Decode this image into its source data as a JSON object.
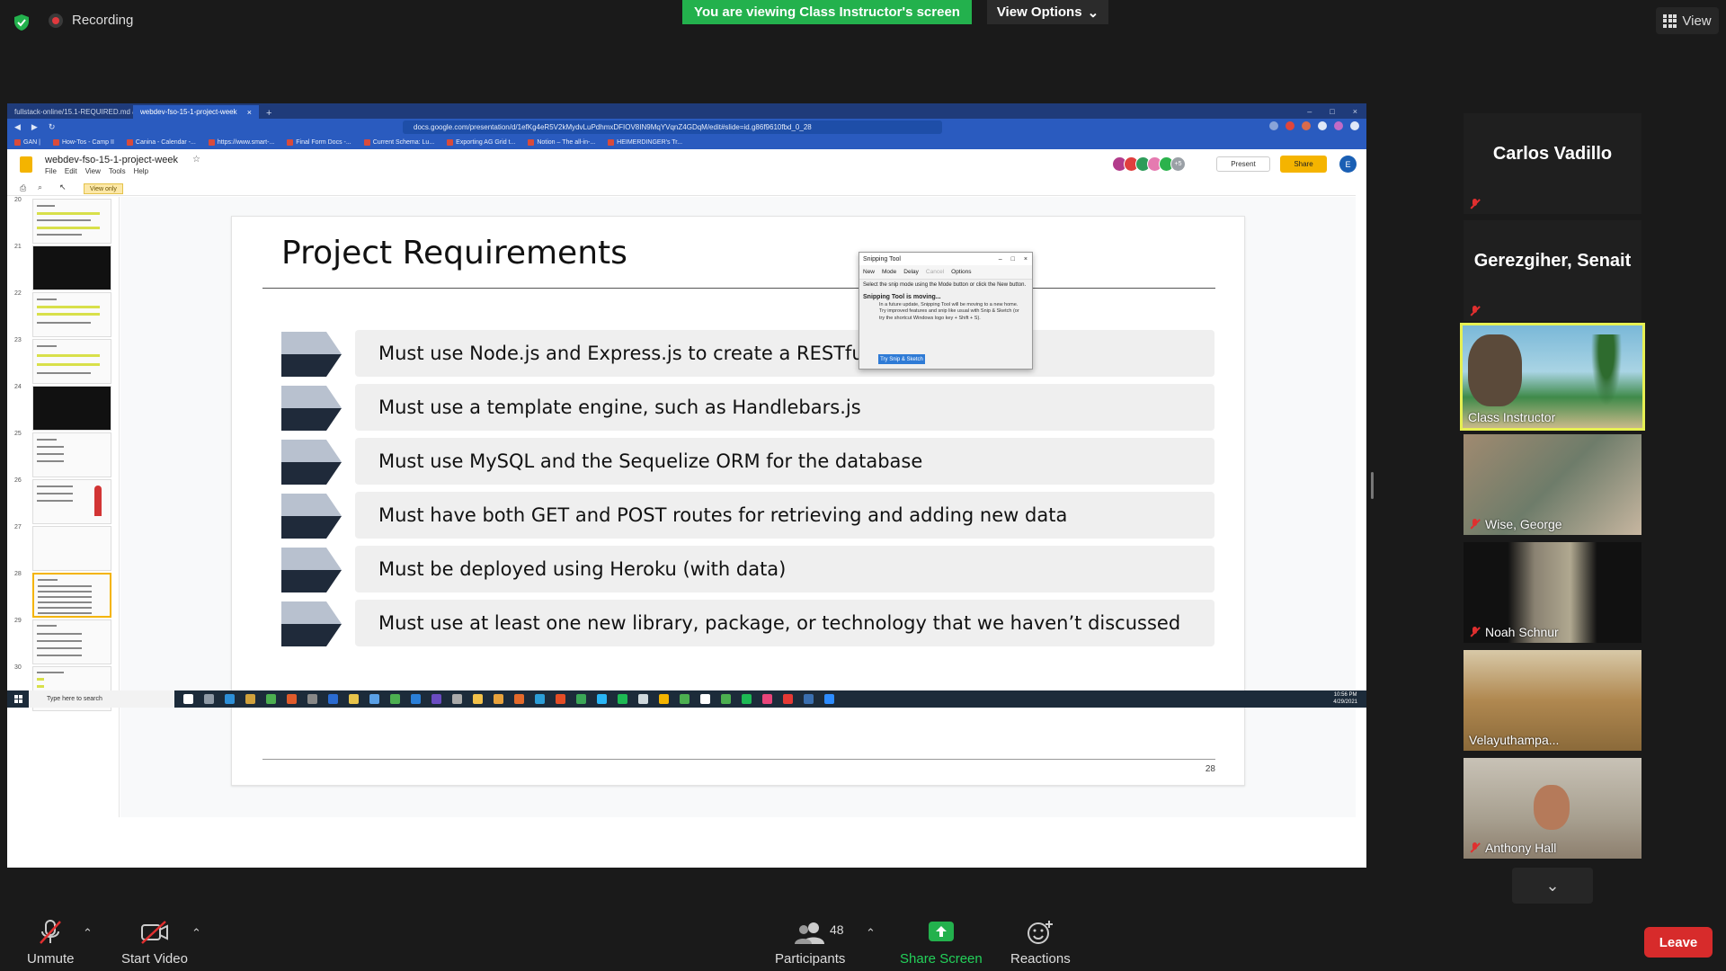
{
  "zoom": {
    "recording_label": "Recording",
    "viewing_banner": "You are viewing Class Instructor's screen",
    "view_options_label": "View Options",
    "view_label": "View",
    "participants_count": "48",
    "controls": {
      "unmute": "Unmute",
      "start_video": "Start Video",
      "participants": "Participants",
      "share_screen": "Share Screen",
      "reactions": "Reactions",
      "leave": "Leave"
    }
  },
  "participants": [
    {
      "name": "Carlos Vadillo",
      "video": false,
      "muted": true
    },
    {
      "name": "Gerezgiher, Senait",
      "video": false,
      "muted": true
    },
    {
      "name": "Class Instructor",
      "video": true,
      "muted": false,
      "active_speaker": true
    },
    {
      "name": "Wise, George",
      "video": true,
      "muted": true
    },
    {
      "name": "Noah Schnur",
      "video": true,
      "muted": true
    },
    {
      "name": "Velayuthampa...",
      "video": true,
      "muted": false
    },
    {
      "name": "Anthony Hall",
      "video": true,
      "muted": true
    }
  ],
  "browser": {
    "tabs": [
      {
        "label": "fullstack-online/15.1-REQUIRED.md at",
        "active": false
      },
      {
        "label": "webdev-fso-15-1-project-week",
        "active": true
      }
    ],
    "url": "docs.google.com/presentation/d/1efKg4eR5V2kMydvLuPdhmxDFIOV8IN9MqYVqnZ4GDqM/edit#slide=id.g86f9610fbd_0_28",
    "bookmarks": [
      "GAN |",
      "How-Tos - Camp II",
      "Canina - Calendar -...",
      "https://www.smart-...",
      "Final Form Docs -...",
      "Current Schema: Lu...",
      "Exporting AG Grid t...",
      "Notion – The all-in-...",
      "HEIMERDINGER's Tr..."
    ]
  },
  "slides_app": {
    "doc_title": "webdev-fso-15-1-project-week",
    "menu": [
      "File",
      "Edit",
      "View",
      "Tools",
      "Help"
    ],
    "extra_collaborators": "+5",
    "present_label": "Present",
    "share_label": "Share",
    "account_initial": "E",
    "view_only_label": "View only",
    "slide_numbers": [
      "20",
      "21",
      "22",
      "23",
      "24",
      "25",
      "26",
      "27",
      "28",
      "29",
      "30"
    ],
    "selected_slide": "28"
  },
  "slide": {
    "title": "Project Requirements",
    "requirements": [
      "Must use Node.js and Express.js to create a RESTful API",
      "Must use a template engine, such as Handlebars.js",
      "Must use MySQL and the Sequelize ORM for the database",
      "Must have both GET and POST routes for retrieving and adding new data",
      "Must be deployed using Heroku (with data)",
      "Must use at least one new library, package, or technology that we haven’t discussed"
    ],
    "page_number": "28"
  },
  "snipping_tool": {
    "title": "Snipping Tool",
    "toolbar": [
      "New",
      "Mode",
      "Delay",
      "Cancel",
      "Options"
    ],
    "instruction": "Select the snip mode using the Mode button or click the New button.",
    "moving_heading": "Snipping Tool is moving...",
    "moving_body": "In a future update, Snipping Tool will be moving to a new home. Try improved features and snip like usual with Snip & Sketch (or try the shortcut Windows logo key + Shift + S).",
    "try_button": "Try Snip & Sketch"
  },
  "taskbar": {
    "search_placeholder": "Type here to search",
    "time": "10:56 PM",
    "date": "4/29/2021"
  },
  "colors": {
    "banner_green": "#23b14d",
    "leave_red": "#d72b2b",
    "active_speaker": "#e6f053",
    "slides_yellow": "#f4b400"
  }
}
